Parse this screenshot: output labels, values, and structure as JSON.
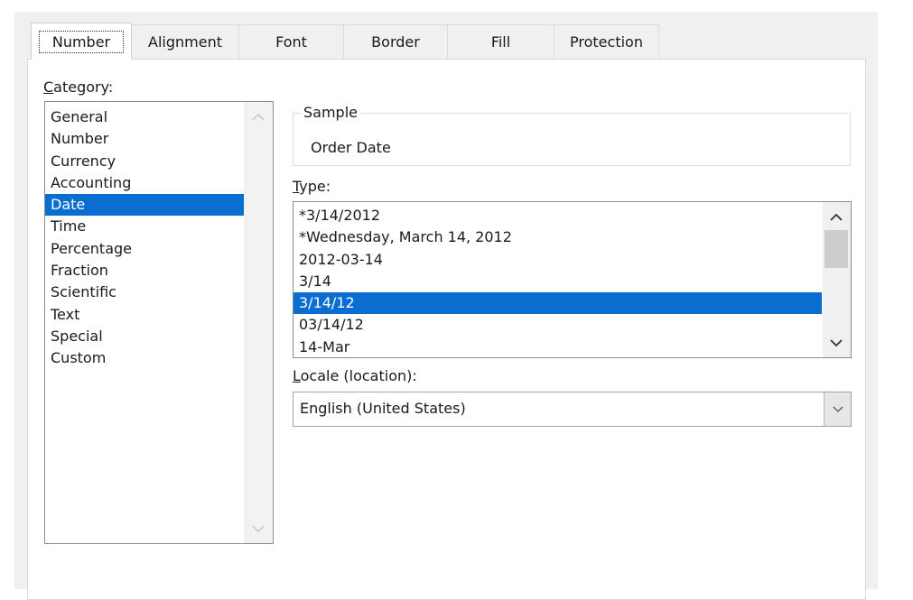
{
  "tabs": [
    {
      "label": "Number",
      "selected": true
    },
    {
      "label": "Alignment",
      "selected": false
    },
    {
      "label": "Font",
      "selected": false
    },
    {
      "label": "Border",
      "selected": false
    },
    {
      "label": "Fill",
      "selected": false
    },
    {
      "label": "Protection",
      "selected": false
    }
  ],
  "category": {
    "label_access": "C",
    "label_rest": "ategory:",
    "items": [
      "General",
      "Number",
      "Currency",
      "Accounting",
      "Date",
      "Time",
      "Percentage",
      "Fraction",
      "Scientific",
      "Text",
      "Special",
      "Custom"
    ],
    "selected": "Date",
    "icons": {
      "scroll_up": "chevron-up-icon",
      "scroll_down": "chevron-down-icon"
    }
  },
  "sample": {
    "title": "Sample",
    "value": "Order Date"
  },
  "type": {
    "label_access": "T",
    "label_rest": "ype:",
    "items": [
      "*3/14/2012",
      "*Wednesday, March 14, 2012",
      "2012-03-14",
      "3/14",
      "3/14/12",
      "03/14/12",
      "14-Mar"
    ],
    "selected": "3/14/12"
  },
  "locale": {
    "label_access": "L",
    "label_rest": "ocale (location):",
    "value": "English (United States)"
  },
  "colors": {
    "selection": "#0a6ed1",
    "dialog_bg": "#f0f0f0"
  }
}
